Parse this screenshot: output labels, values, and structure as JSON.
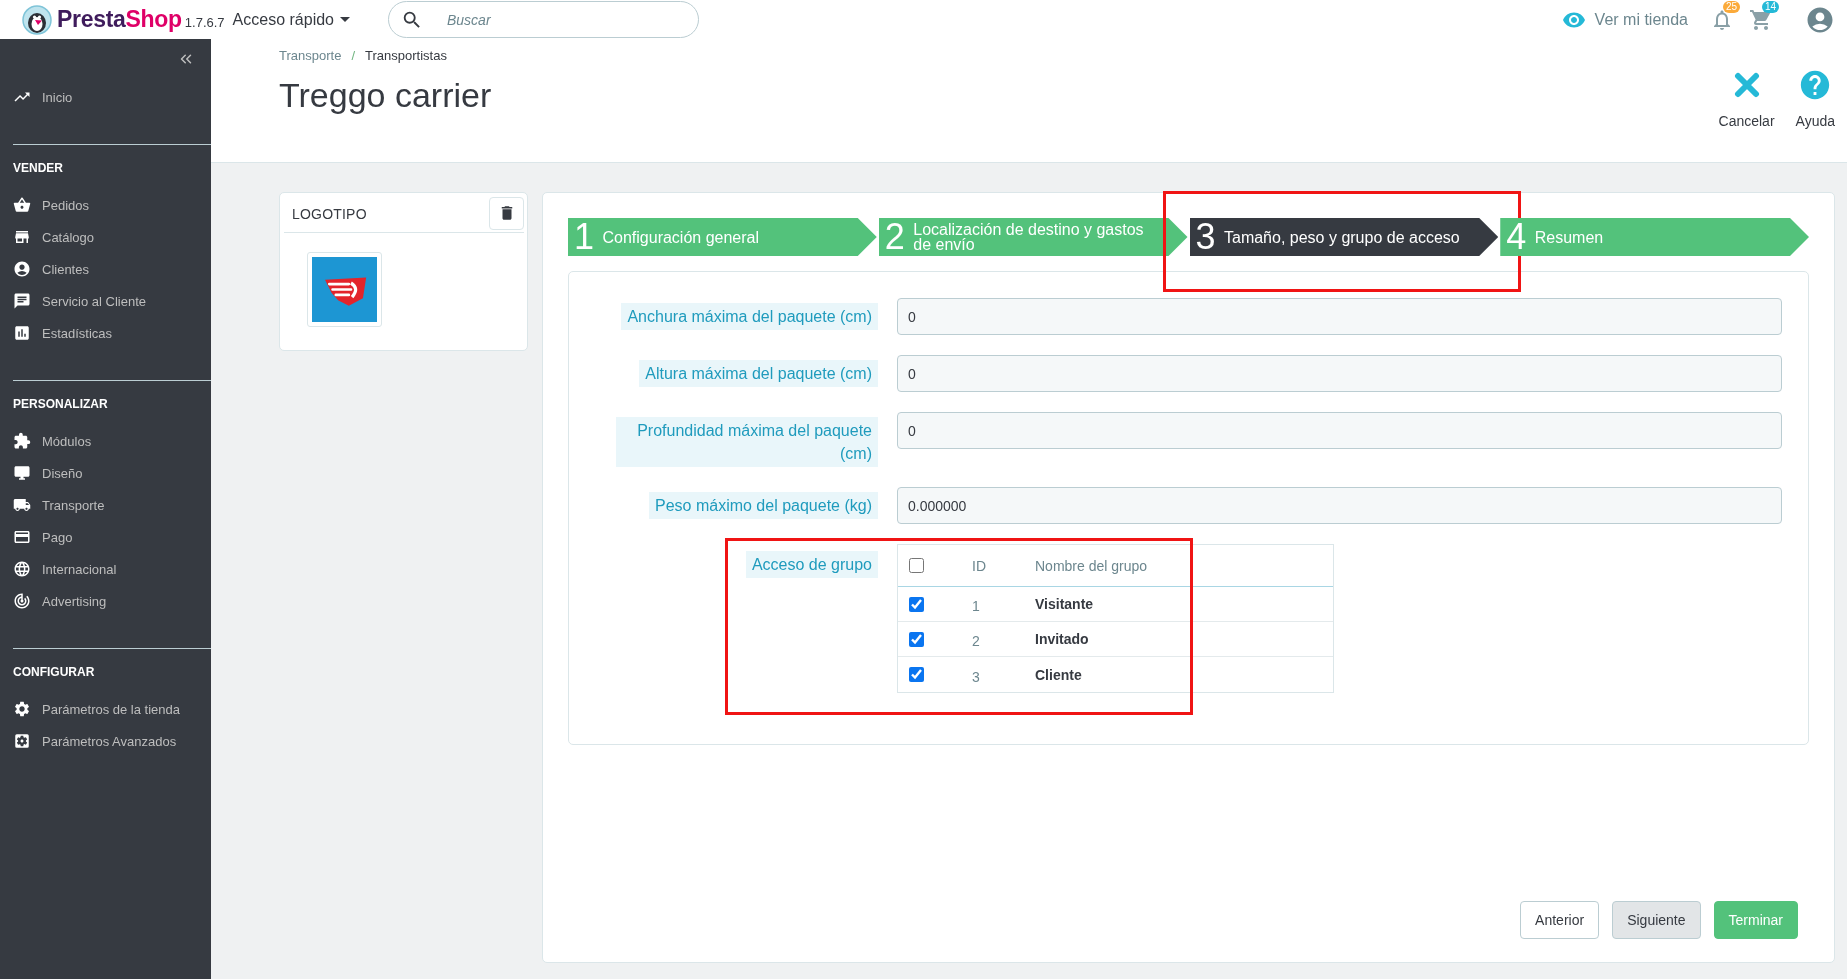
{
  "topbar": {
    "brand": {
      "primary": "Presta",
      "accent": "Shop"
    },
    "version": "1.7.6.7",
    "quick_access": "Acceso rápido",
    "search": {
      "placeholder": "Buscar"
    },
    "view_store": "Ver mi tienda",
    "notifications": [
      {
        "count": "25",
        "color": "#fbaa3a"
      },
      {
        "count": "14",
        "color": "#25b9d7"
      }
    ]
  },
  "sidebar": {
    "home": {
      "label": "Inicio"
    },
    "sections": [
      {
        "title": "VENDER",
        "items": [
          {
            "label": "Pedidos"
          },
          {
            "label": "Catálogo"
          },
          {
            "label": "Clientes"
          },
          {
            "label": "Servicio al Cliente"
          },
          {
            "label": "Estadísticas"
          }
        ]
      },
      {
        "title": "PERSONALIZAR",
        "items": [
          {
            "label": "Módulos"
          },
          {
            "label": "Diseño"
          },
          {
            "label": "Transporte"
          },
          {
            "label": "Pago"
          },
          {
            "label": "Internacional"
          },
          {
            "label": "Advertising"
          }
        ]
      },
      {
        "title": "CONFIGURAR",
        "items": [
          {
            "label": "Parámetros de la tienda"
          },
          {
            "label": "Parámetros Avanzados"
          }
        ]
      }
    ]
  },
  "page_header": {
    "breadcrumb": {
      "items": [
        {
          "label": "Transporte"
        },
        {
          "label": "Transportistas"
        }
      ],
      "separator": "/"
    },
    "title": "Treggo carrier",
    "toolbar": [
      {
        "label": "Cancelar"
      },
      {
        "label": "Ayuda"
      }
    ]
  },
  "logo_card": {
    "title": "LOGOTIPO"
  },
  "wizard": {
    "steps": [
      {
        "number": "1",
        "label": "Configuración general",
        "selected": false,
        "highlighted": false
      },
      {
        "number": "2",
        "label": "Localización de destino y gastos de envío",
        "selected": false,
        "highlighted": false
      },
      {
        "number": "3",
        "label": "Tamaño, peso y grupo de acceso",
        "selected": true,
        "highlighted": true
      },
      {
        "number": "4",
        "label": "Resumen",
        "selected": false,
        "highlighted": false
      }
    ]
  },
  "form": {
    "fields": [
      {
        "label": "Anchura máxima del paquete (cm)",
        "value": "0"
      },
      {
        "label": "Altura máxima del paquete (cm)",
        "value": "0"
      },
      {
        "label": "Profundidad máxima del paquete (cm)",
        "value": "0"
      },
      {
        "label": "Peso máximo del paquete (kg)",
        "value": "0.000000"
      }
    ],
    "group_access": {
      "label": "Acceso de grupo",
      "highlighted": true,
      "select_all": {
        "checked": false
      },
      "columns": [
        "ID",
        "Nombre del grupo"
      ],
      "rows": [
        {
          "checked": true,
          "id": "1",
          "name": "Visitante"
        },
        {
          "checked": true,
          "id": "2",
          "name": "Invitado"
        },
        {
          "checked": true,
          "id": "3",
          "name": "Cliente"
        }
      ]
    }
  },
  "footer_buttons": [
    {
      "label": "Anterior",
      "kind": "default"
    },
    {
      "label": "Siguiente",
      "kind": "muted"
    },
    {
      "label": "Terminar",
      "kind": "primary"
    }
  ]
}
